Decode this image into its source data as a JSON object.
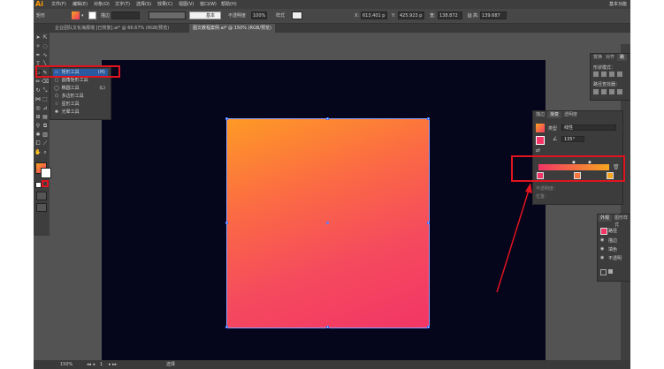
{
  "app": {
    "logo": "Ai"
  },
  "menu": [
    "文件(F)",
    "编辑(E)",
    "对象(O)",
    "文字(T)",
    "选择(S)",
    "效果(C)",
    "视图(V)",
    "窗口(W)",
    "帮助(H)"
  ],
  "workspace": "基本功能",
  "control_bar": {
    "object_type": "矩形",
    "stroke_label": "描边",
    "stroke_style": "基本",
    "opacity_label": "不透明度",
    "opacity_value": "100%",
    "style_label": "样式",
    "x_label": "X:",
    "x_value": "613.401 p",
    "y_label": "Y:",
    "y_value": "425.923 p",
    "w_label": "宽:",
    "w_value": "138.872",
    "h_label": "高:",
    "h_value": "139.687"
  },
  "doc_tabs": [
    {
      "label": "企业团队文化海报墙 [已恢复].ai* @ 66.67% (RGB/预览)",
      "active": false
    },
    {
      "label": "图文教程案例.ai* @ 150% (RGB/预览)",
      "active": true
    }
  ],
  "tool_flyout": {
    "items": [
      {
        "icon": "rect-icon",
        "glyph": "▭",
        "label": "矩形工具",
        "shortcut": "(M)"
      },
      {
        "icon": "rounded-rect-icon",
        "glyph": "▢",
        "label": "圆角矩形工具",
        "shortcut": ""
      },
      {
        "icon": "ellipse-icon",
        "glyph": "◯",
        "label": "椭圆工具",
        "shortcut": "(L)"
      },
      {
        "icon": "polygon-icon",
        "glyph": "⬡",
        "label": "多边形工具",
        "shortcut": ""
      },
      {
        "icon": "star-icon",
        "glyph": "☆",
        "label": "星形工具",
        "shortcut": ""
      },
      {
        "icon": "flare-icon",
        "glyph": "✺",
        "label": "光晕工具",
        "shortcut": ""
      }
    ]
  },
  "transform_panel": {
    "tabs": [
      "变换",
      "对齐",
      "路"
    ],
    "shape_mode_label": "形状模式：",
    "pathfinder_label": "路径查找器："
  },
  "gradient_panel": {
    "tabs": [
      "描边",
      "渐变",
      "透明度"
    ],
    "type_label": "类型",
    "type_value": "线性",
    "angle_value": "135°",
    "opacity_label": "不透明度：",
    "location_label": "位置：",
    "colors": {
      "start": "#f23566",
      "end": "#f7a51f"
    }
  },
  "layers_panel": {
    "tabs": [
      "外观",
      "图形样式"
    ],
    "header": "路径",
    "rows": [
      "描边",
      "填色",
      "不透明"
    ]
  },
  "status": {
    "zoom": "150%",
    "artboard": "1",
    "tool": "选择"
  },
  "colors": {
    "art_top": "#fe9a25",
    "art_bottom": "#f23566",
    "canvas": "#05051c",
    "highlight": "#e0141e"
  }
}
